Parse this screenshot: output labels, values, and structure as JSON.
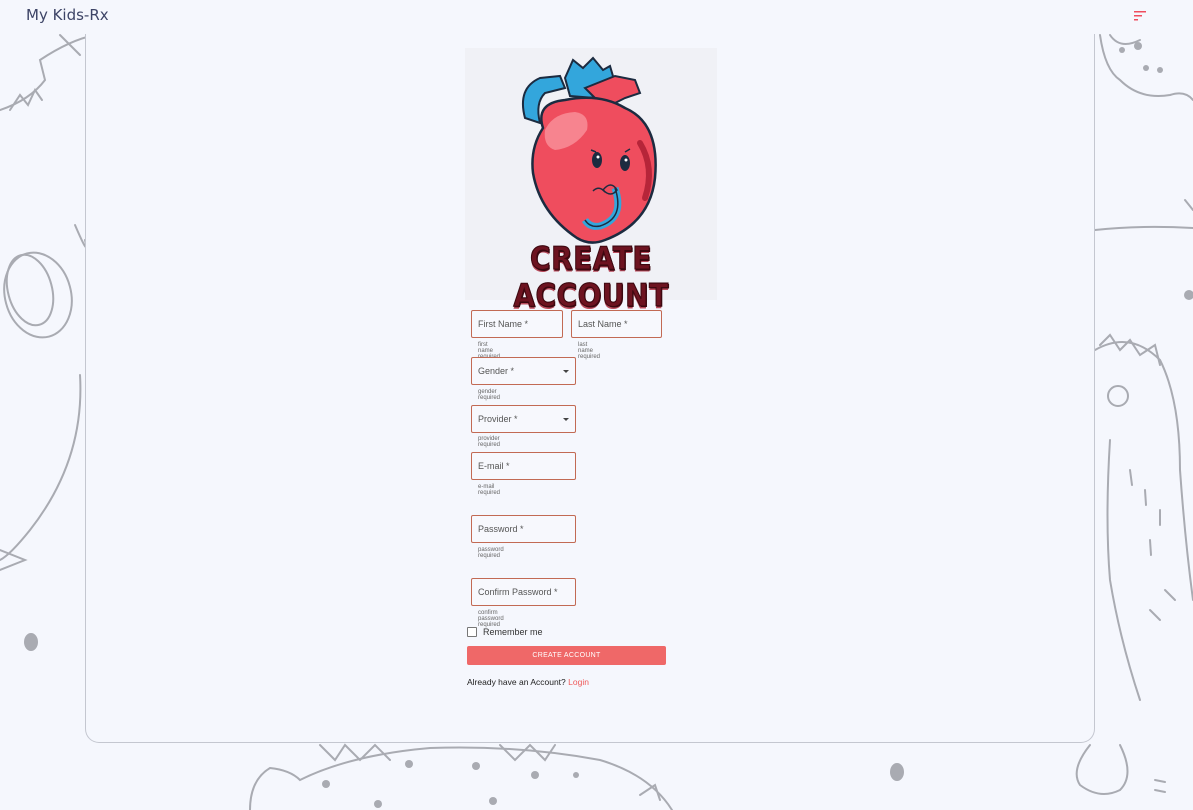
{
  "app": {
    "title": "My Kids-Rx"
  },
  "header": {
    "menu_icon": "sort-menu-icon",
    "menu_color": "#ef4d5e"
  },
  "hero": {
    "title": "CREATE ACCOUNT",
    "image": "cartoon-heart-icon"
  },
  "form": {
    "first_name": {
      "label": "First Name *",
      "helper": "first name required"
    },
    "last_name": {
      "label": "Last Name *",
      "helper": "last name required"
    },
    "gender": {
      "label": "Gender *",
      "helper": "gender required"
    },
    "provider": {
      "label": "Provider *",
      "helper": "provider required"
    },
    "email": {
      "label": "E-mail *",
      "helper": "e-mail required"
    },
    "password": {
      "label": "Password *",
      "helper": "password required"
    },
    "confirm_password": {
      "label": "Confirm Password *",
      "helper": "confirm password required"
    },
    "remember_label": "Remember me",
    "create_button": "CREATE ACCOUNT",
    "login_prompt": "Already have an Account?",
    "login_link": "Login"
  },
  "colors": {
    "accent": "#ef6868",
    "field_border": "#c26a54",
    "background": "#f5f7fd"
  }
}
